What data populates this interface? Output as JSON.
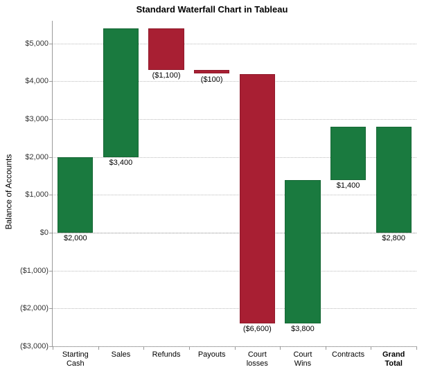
{
  "chart_data": {
    "type": "bar",
    "subtype": "waterfall",
    "title": "Standard Waterfall Chart in Tableau",
    "ylabel": "Balance of Accounts",
    "ylim": [
      -3000,
      5600
    ],
    "yticks": [
      -3000,
      -2000,
      -1000,
      0,
      1000,
      2000,
      3000,
      4000,
      5000
    ],
    "ytick_labels": [
      "($3,000)",
      "($2,000)",
      "($1,000)",
      "$0",
      "$1,000",
      "$2,000",
      "$3,000",
      "$4,000",
      "$5,000"
    ],
    "categories": [
      "Starting Cash",
      "Sales",
      "Refunds",
      "Payouts",
      "Court losses",
      "Court Wins",
      "Contracts",
      "Grand Total"
    ],
    "values": [
      2000,
      3400,
      -1100,
      -100,
      -6600,
      3800,
      1400,
      2800
    ],
    "value_labels": [
      "$2,000",
      "$3,400",
      "($1,100)",
      "($100)",
      "($6,600)",
      "$3,800",
      "$1,400",
      "$2,800"
    ],
    "totals_index": [
      7
    ],
    "colors": {
      "positive": "#1a7a3f",
      "negative": "#a81f33"
    }
  }
}
